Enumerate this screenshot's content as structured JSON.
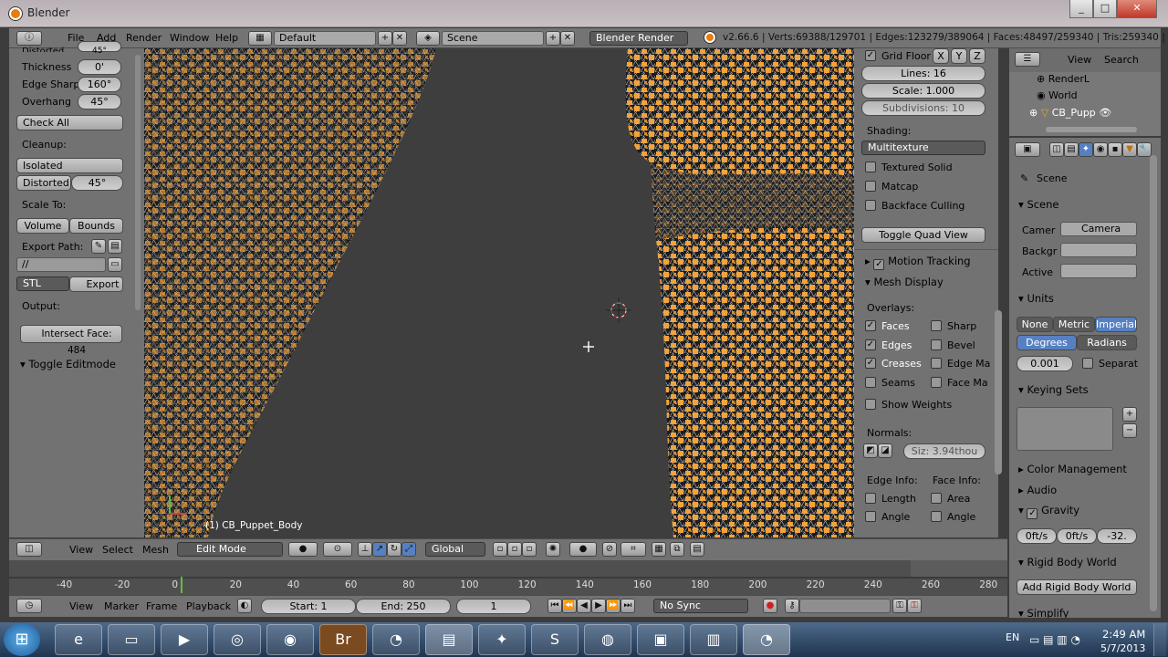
{
  "window": {
    "title": "Blender",
    "min": "_",
    "max": "□",
    "close": "✕"
  },
  "menu": {
    "file": "File",
    "add": "Add",
    "render": "Render",
    "window": "Window",
    "help": "Help",
    "layout": "Default",
    "scene": "Scene",
    "engine": "Blender Render",
    "stats": "v2.66.6 | Verts:69388/129701 | Edges:123279/389064 | Faces:48497/259340 | Tris:259340 | Me"
  },
  "tools": {
    "distorted_top": "Distorted",
    "distorted_top_val": "45°",
    "thickness": "Thickness",
    "thickness_val": "0'",
    "edge_sharp": "Edge Sharp",
    "edge_sharp_val": "160°",
    "overhang": "Overhang",
    "overhang_val": "45°",
    "check_all": "Check All",
    "cleanup": "Cleanup:",
    "isolated": "Isolated",
    "distorted": "Distorted",
    "distorted_val": "45°",
    "scale_to": "Scale To:",
    "volume": "Volume",
    "bounds": "Bounds",
    "export_path": "Export Path:",
    "path_val": "//",
    "format": "STL",
    "export": "Export",
    "output": "Output:",
    "intersect": "Intersect Face: 484",
    "toggle_editmode": "Toggle Editmode"
  },
  "viewport": {
    "object_label": "(1) CB_Puppet_Body"
  },
  "props": {
    "grid_floor": "Grid Floor",
    "x": "X",
    "y": "Y",
    "z": "Z",
    "lines": "Lines: 16",
    "scale": "Scale: 1.000",
    "subdivisions": "Subdivisions: 10",
    "shading": "Shading:",
    "multitexture": "Multitexture",
    "textured_solid": "Textured Solid",
    "matcap": "Matcap",
    "backface": "Backface Culling",
    "quad_view": "Toggle Quad View",
    "motion_tracking": "Motion Tracking",
    "mesh_display": "Mesh Display",
    "overlays": "Overlays:",
    "faces": "Faces",
    "sharp": "Sharp",
    "edges": "Edges",
    "bevel": "Bevel",
    "creases": "Creases",
    "edge_ma": "Edge Ma",
    "seams": "Seams",
    "face_ma": "Face Ma",
    "show_weights": "Show Weights",
    "normals": "Normals:",
    "normal_size": "Siz: 3.94thou",
    "edge_info": "Edge Info:",
    "face_info": "Face Info:",
    "length": "Length",
    "area": "Area",
    "angle1": "Angle",
    "angle2": "Angle"
  },
  "outliner": {
    "view": "View",
    "search": "Search",
    "renderl": "RenderL",
    "world": "World",
    "cb": "CB_Pupp"
  },
  "scene_props": {
    "scene_label": "Scene",
    "scene_panel": "Scene",
    "camera_lbl": "Camer",
    "camera_val": "Camera",
    "backgr": "Backgr",
    "active": "Active",
    "units": "Units",
    "none": "None",
    "metric": "Metric",
    "imperial": "Imperial",
    "degrees": "Degrees",
    "radians": "Radians",
    "scale_val": "0.001",
    "separate": "Separat",
    "keying_sets": "Keying Sets",
    "color_mgmt": "Color Management",
    "audio": "Audio",
    "gravity": "Gravity",
    "g1": "0ft/s",
    "g2": "0ft/s",
    "g3": "-32.",
    "rigid_world": "Rigid Body World",
    "add_rigid": "Add Rigid Body World",
    "simplify": "Simplify"
  },
  "v3dheader": {
    "view": "View",
    "select": "Select",
    "mesh": "Mesh",
    "mode": "Edit Mode",
    "orient": "Global"
  },
  "timeline": {
    "ticks": [
      "-40",
      "-20",
      "0",
      "20",
      "40",
      "60",
      "80",
      "100",
      "120",
      "140",
      "160",
      "180",
      "200",
      "220",
      "240",
      "260",
      "280"
    ],
    "view": "View",
    "marker": "Marker",
    "frame": "Frame",
    "playback": "Playback",
    "start": "Start: 1",
    "end": "End: 250",
    "current": "1",
    "sync": "No Sync"
  },
  "taskbar": {
    "lang": "EN",
    "time": "2:49 AM",
    "date": "5/7/2013"
  },
  "colors": {
    "accent": "#e87d0d",
    "selected_blue": "#5680c2",
    "mesh_orange": "#f3a33c"
  }
}
